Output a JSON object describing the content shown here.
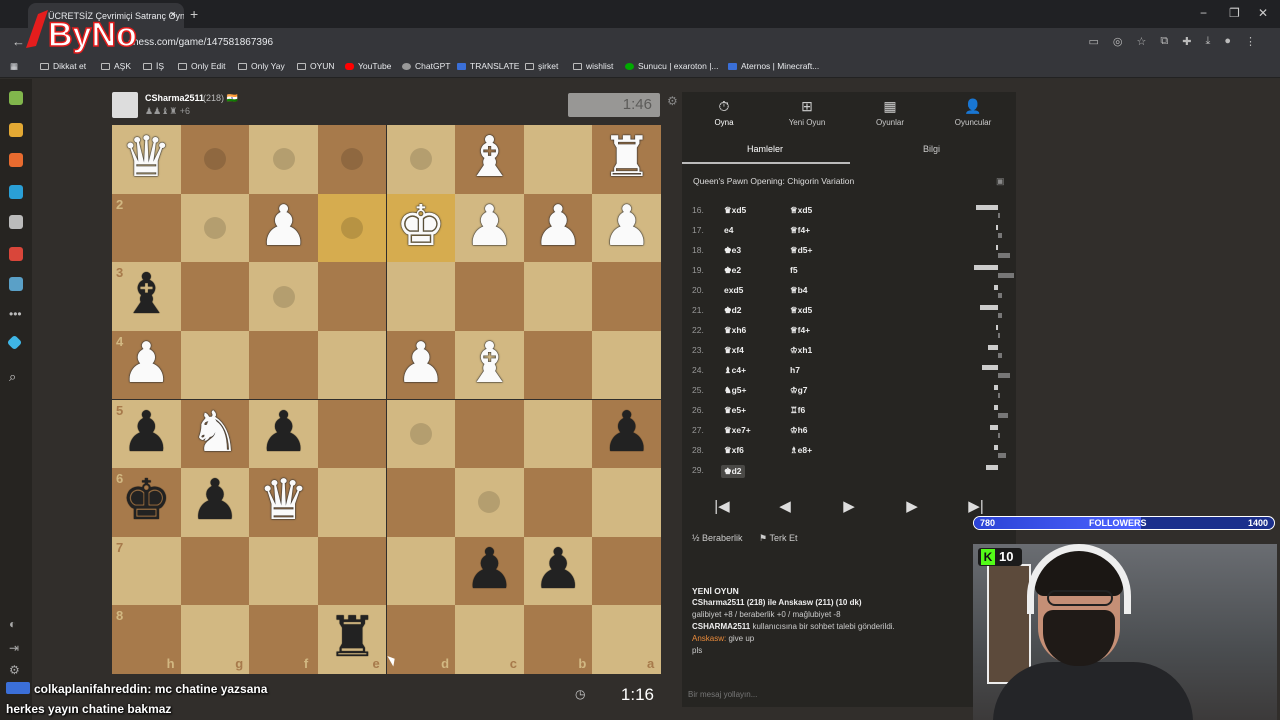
{
  "browser": {
    "tab_title": "ÜCRETSİZ Çevrimiçi Satranç Oyna",
    "tab_close": "×",
    "new_tab": "+",
    "url": "chess.com/game/147581867396",
    "window_controls": [
      "−",
      "❐",
      "✕"
    ],
    "logo_text": "ByNo",
    "bookmarks": [
      {
        "label": "Dikkat et",
        "icon": "folder-icon"
      },
      {
        "label": "AŞK",
        "icon": "folder-icon"
      },
      {
        "label": "İŞ",
        "icon": "folder-icon"
      },
      {
        "label": "Only Edit",
        "icon": "folder-icon"
      },
      {
        "label": "Only Yay",
        "icon": "folder-icon"
      },
      {
        "label": "OYUN",
        "icon": "folder-icon"
      },
      {
        "label": "YouTube",
        "icon": "youtube-icon"
      },
      {
        "label": "ChatGPT",
        "icon": "chatgpt-icon"
      },
      {
        "label": "TRANSLATE",
        "icon": "translate-icon"
      },
      {
        "label": "şirket",
        "icon": "folder-icon"
      },
      {
        "label": "wishlist",
        "icon": "folder-icon"
      },
      {
        "label": "Sunucu | exaroton |...",
        "icon": "exaroton-icon"
      },
      {
        "label": "Aternos | Minecraft...",
        "icon": "aternos-icon"
      }
    ]
  },
  "game": {
    "opponent": {
      "name": "CSharma2511",
      "rating": "(218)",
      "flag": "🇮🇳",
      "material": "+6",
      "clock": "1:46"
    },
    "player_clock": "1:16",
    "files": [
      "h",
      "g",
      "f",
      "e",
      "d",
      "c",
      "b",
      "a"
    ],
    "ranks": [
      "2",
      "3",
      "4",
      "5",
      "6",
      "7",
      "8"
    ],
    "pieces": [
      {
        "sq": "h1",
        "p": "♛",
        "c": "w"
      },
      {
        "sq": "c1",
        "p": "♝",
        "c": "w"
      },
      {
        "sq": "a1",
        "p": "♜",
        "c": "w"
      },
      {
        "sq": "f2",
        "p": "♟",
        "c": "w"
      },
      {
        "sq": "d2",
        "p": "♚",
        "c": "w"
      },
      {
        "sq": "c2",
        "p": "♟",
        "c": "w"
      },
      {
        "sq": "b2",
        "p": "♟",
        "c": "w"
      },
      {
        "sq": "a2",
        "p": "♟",
        "c": "w"
      },
      {
        "sq": "h3",
        "p": "♝",
        "c": "b"
      },
      {
        "sq": "h4",
        "p": "♟",
        "c": "w"
      },
      {
        "sq": "d4",
        "p": "♟",
        "c": "w"
      },
      {
        "sq": "c4",
        "p": "♝",
        "c": "w"
      },
      {
        "sq": "h5",
        "p": "♟",
        "c": "b"
      },
      {
        "sq": "g5",
        "p": "♞",
        "c": "w"
      },
      {
        "sq": "f5",
        "p": "♟",
        "c": "b"
      },
      {
        "sq": "a5",
        "p": "♟",
        "c": "b"
      },
      {
        "sq": "h6",
        "p": "♚",
        "c": "b"
      },
      {
        "sq": "g6",
        "p": "♟",
        "c": "b"
      },
      {
        "sq": "f6",
        "p": "♛",
        "c": "w"
      },
      {
        "sq": "c7",
        "p": "♟",
        "c": "b"
      },
      {
        "sq": "b7",
        "p": "♟",
        "c": "b"
      },
      {
        "sq": "e8",
        "p": "♜",
        "c": "b"
      }
    ],
    "highlights": [
      "e2",
      "d2"
    ],
    "dots": [
      "g1",
      "f1",
      "e1",
      "d1",
      "g2",
      "e2",
      "f3",
      "d5",
      "c6"
    ]
  },
  "panel": {
    "tabs": [
      {
        "label": "Oyna",
        "icon": "⏱"
      },
      {
        "label": "Yeni Oyun",
        "icon": "⊞"
      },
      {
        "label": "Oyunlar",
        "icon": "▦"
      },
      {
        "label": "Oyuncular",
        "icon": "👤"
      }
    ],
    "subtabs": [
      "Hamleler",
      "Bilgi"
    ],
    "opening": "Queen's Pawn Opening: Chigorin Variation",
    "moves": [
      {
        "n": "16.",
        "w": "♛xd5",
        "b": "♕xd5",
        "tw": 0.55,
        "tb": 0.05
      },
      {
        "n": "17.",
        "w": "e4",
        "b": "♕f4+",
        "tw": 0.06,
        "tb": 0.1
      },
      {
        "n": "18.",
        "w": "♚e3",
        "b": "♕d5+",
        "tw": 0.06,
        "tb": 0.3
      },
      {
        "n": "19.",
        "w": "♚e2",
        "b": "f5",
        "tw": 0.6,
        "tb": 0.4
      },
      {
        "n": "20.",
        "w": "exd5",
        "b": "♕b4",
        "tw": 0.1,
        "tb": 0.1
      },
      {
        "n": "21.",
        "w": "♚d2",
        "b": "♕xd5",
        "tw": 0.45,
        "tb": 0.1
      },
      {
        "n": "22.",
        "w": "♛xh6",
        "b": "♕f4+",
        "tw": 0.05,
        "tb": 0.05
      },
      {
        "n": "23.",
        "w": "♛xf4",
        "b": "♔xh1",
        "tw": 0.25,
        "tb": 0.1
      },
      {
        "n": "24.",
        "w": "♝c4+",
        "b": "h7",
        "tw": 0.4,
        "tb": 0.3
      },
      {
        "n": "25.",
        "w": "♞g5+",
        "b": "♔g7",
        "tw": 0.1,
        "tb": 0.05
      },
      {
        "n": "26.",
        "w": "♛e5+",
        "b": "♖f6",
        "tw": 0.1,
        "tb": 0.25
      },
      {
        "n": "27.",
        "w": "♛xe7+",
        "b": "♔h6",
        "tw": 0.2,
        "tb": 0.05
      },
      {
        "n": "28.",
        "w": "♛xf6",
        "b": "♗e8+",
        "tw": 0.1,
        "tb": 0.2
      },
      {
        "n": "29.",
        "w": "♚d2",
        "b": "",
        "tw": 0.3,
        "tb": 0
      }
    ],
    "nav": [
      "|◀",
      "◀",
      "▶",
      "▶",
      "▶|"
    ],
    "actions": [
      "½ Beraberlik",
      "⚑ Terk Et"
    ],
    "chat_header": "YENİ OYUN",
    "chat_line1": "CSharma2511 (218) ile Anskasw (211) (10 dk)",
    "chat_line2": "galibiyet +8 / beraberlik +0 / mağlubiyet -8",
    "chat_line3_user": "CSHARMA2511",
    "chat_line3_rest": " kullanıcısına bir sohbet talebi gönderildi.",
    "chat_line4_user": "Anskasw:",
    "chat_line4_rest": " give up",
    "chat_line5": "pls",
    "chat_placeholder": "Bir mesaj yollayın..."
  },
  "stream": {
    "followers_current": "780",
    "followers_label": "FOLLOWERS",
    "followers_goal": "1400",
    "followers_fraction": 0.557,
    "kick_count": "10",
    "kick_letter": "K",
    "overlay_user": "colkaplanifahreddin",
    "overlay_msg1": ": mc chatine yazsana",
    "overlay_msg2": "herkes yayın chatine bakmaz"
  }
}
